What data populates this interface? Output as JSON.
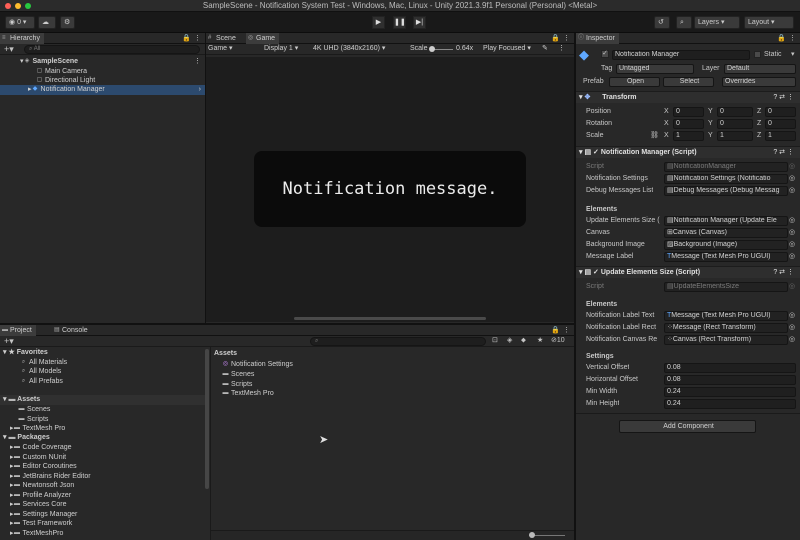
{
  "window": {
    "title": "SampleScene - Notification System Test - Windows, Mac, Linux - Unity 2021.3.9f1 Personal (Personal) <Metal>"
  },
  "toolbar": {
    "account_label": "⊙",
    "cloud_label": "☁",
    "collab_count": "0",
    "layers_label": "Layers",
    "layout_label": "Layout"
  },
  "hierarchy": {
    "tab_label": "Hierarchy",
    "search_placeholder": "All",
    "scene_name": "SampleScene",
    "items": [
      {
        "label": "Main Camera"
      },
      {
        "label": "Directional Light"
      },
      {
        "label": "Notification Manager"
      }
    ]
  },
  "scene_tabs": {
    "scene": "Scene",
    "game": "Game"
  },
  "game_bar": {
    "mode": "Game",
    "display": "Display 1",
    "resolution": "4K UHD (3840x2160)",
    "scale_label": "Scale",
    "scale_value": "0.64x",
    "play_mode": "Play Focused"
  },
  "game_view": {
    "notification_text": "Notification message."
  },
  "project": {
    "tab_project": "Project",
    "tab_console": "Console",
    "count_label": "10",
    "favorites_label": "Favorites",
    "favorites": [
      "All Materials",
      "All Models",
      "All Prefabs"
    ],
    "assets_label": "Assets",
    "assets_children": [
      "Scenes",
      "Scripts",
      "TextMesh Pro"
    ],
    "packages_label": "Packages",
    "packages": [
      "Code Coverage",
      "Custom NUnit",
      "Editor Coroutines",
      "JetBrains Rider Editor",
      "Newtonsoft Json",
      "Profile Analyzer",
      "Services Core",
      "Settings Manager",
      "Test Framework",
      "TextMeshPro"
    ],
    "breadcrumb": "Assets",
    "content_items": [
      "Notification Settings",
      "Scenes",
      "Scripts",
      "TextMesh Pro"
    ]
  },
  "inspector": {
    "tab_label": "Inspector",
    "object_name": "Notification Manager",
    "static_label": "Static",
    "tag_label": "Tag",
    "tag_value": "Untagged",
    "layer_label": "Layer",
    "layer_value": "Default",
    "prefab_label": "Prefab",
    "open_label": "Open",
    "select_label": "Select",
    "overrides_label": "Overrides",
    "transform": {
      "title": "Transform",
      "position_label": "Position",
      "rotation_label": "Rotation",
      "scale_label": "Scale",
      "position": [
        "0",
        "0",
        "0"
      ],
      "rotation": [
        "0",
        "0",
        "0"
      ],
      "scale": [
        "1",
        "1",
        "1"
      ],
      "axis": [
        "X",
        "Y",
        "Z"
      ]
    },
    "manager_script": {
      "title": "Notification Manager (Script)",
      "script_label": "Script",
      "script_value": "NotificationManager",
      "settings_label": "Notification Settings",
      "settings_value": "Notification Settings (Notificatio",
      "debug_label": "Debug Messages List",
      "debug_value": "Debug Messages (Debug Messag",
      "elements_header": "Elements",
      "update_label": "Update Elements Size (",
      "update_value": "Notification Manager (Update Ele",
      "canvas_label": "Canvas",
      "canvas_value": "Canvas (Canvas)",
      "bg_label": "Background Image",
      "bg_value": "Background (Image)",
      "message_label": "Message Label",
      "message_value": "Message (Text Mesh Pro UGUI)"
    },
    "update_script": {
      "title": "Update Elements Size (Script)",
      "script_label": "Script",
      "script_value": "UpdateElementsSize",
      "elements_header": "Elements",
      "label_text_label": "Notification Label Text",
      "label_text_value": "Message (Text Mesh Pro UGUI)",
      "label_rect_label": "Notification Label Rect",
      "label_rect_value": "Message (Rect Transform)",
      "canvas_rect_label": "Notification Canvas Re",
      "canvas_rect_value": "Canvas (Rect Transform)",
      "settings_header": "Settings",
      "vertical_offset_label": "Vertical Offset",
      "vertical_offset_value": "0.08",
      "horizontal_offset_label": "Horizontal Offset",
      "horizontal_offset_value": "0.08",
      "min_width_label": "Min Width",
      "min_width_value": "0.24",
      "min_height_label": "Min Height",
      "min_height_value": "0.24"
    },
    "add_component_label": "Add Component"
  },
  "colors": {
    "accent_blue": "#3d6ea8",
    "selected_row": "#2c4a6e",
    "traffic_red": "#ff5f57",
    "traffic_yellow": "#febc2e",
    "traffic_green": "#28c840"
  }
}
